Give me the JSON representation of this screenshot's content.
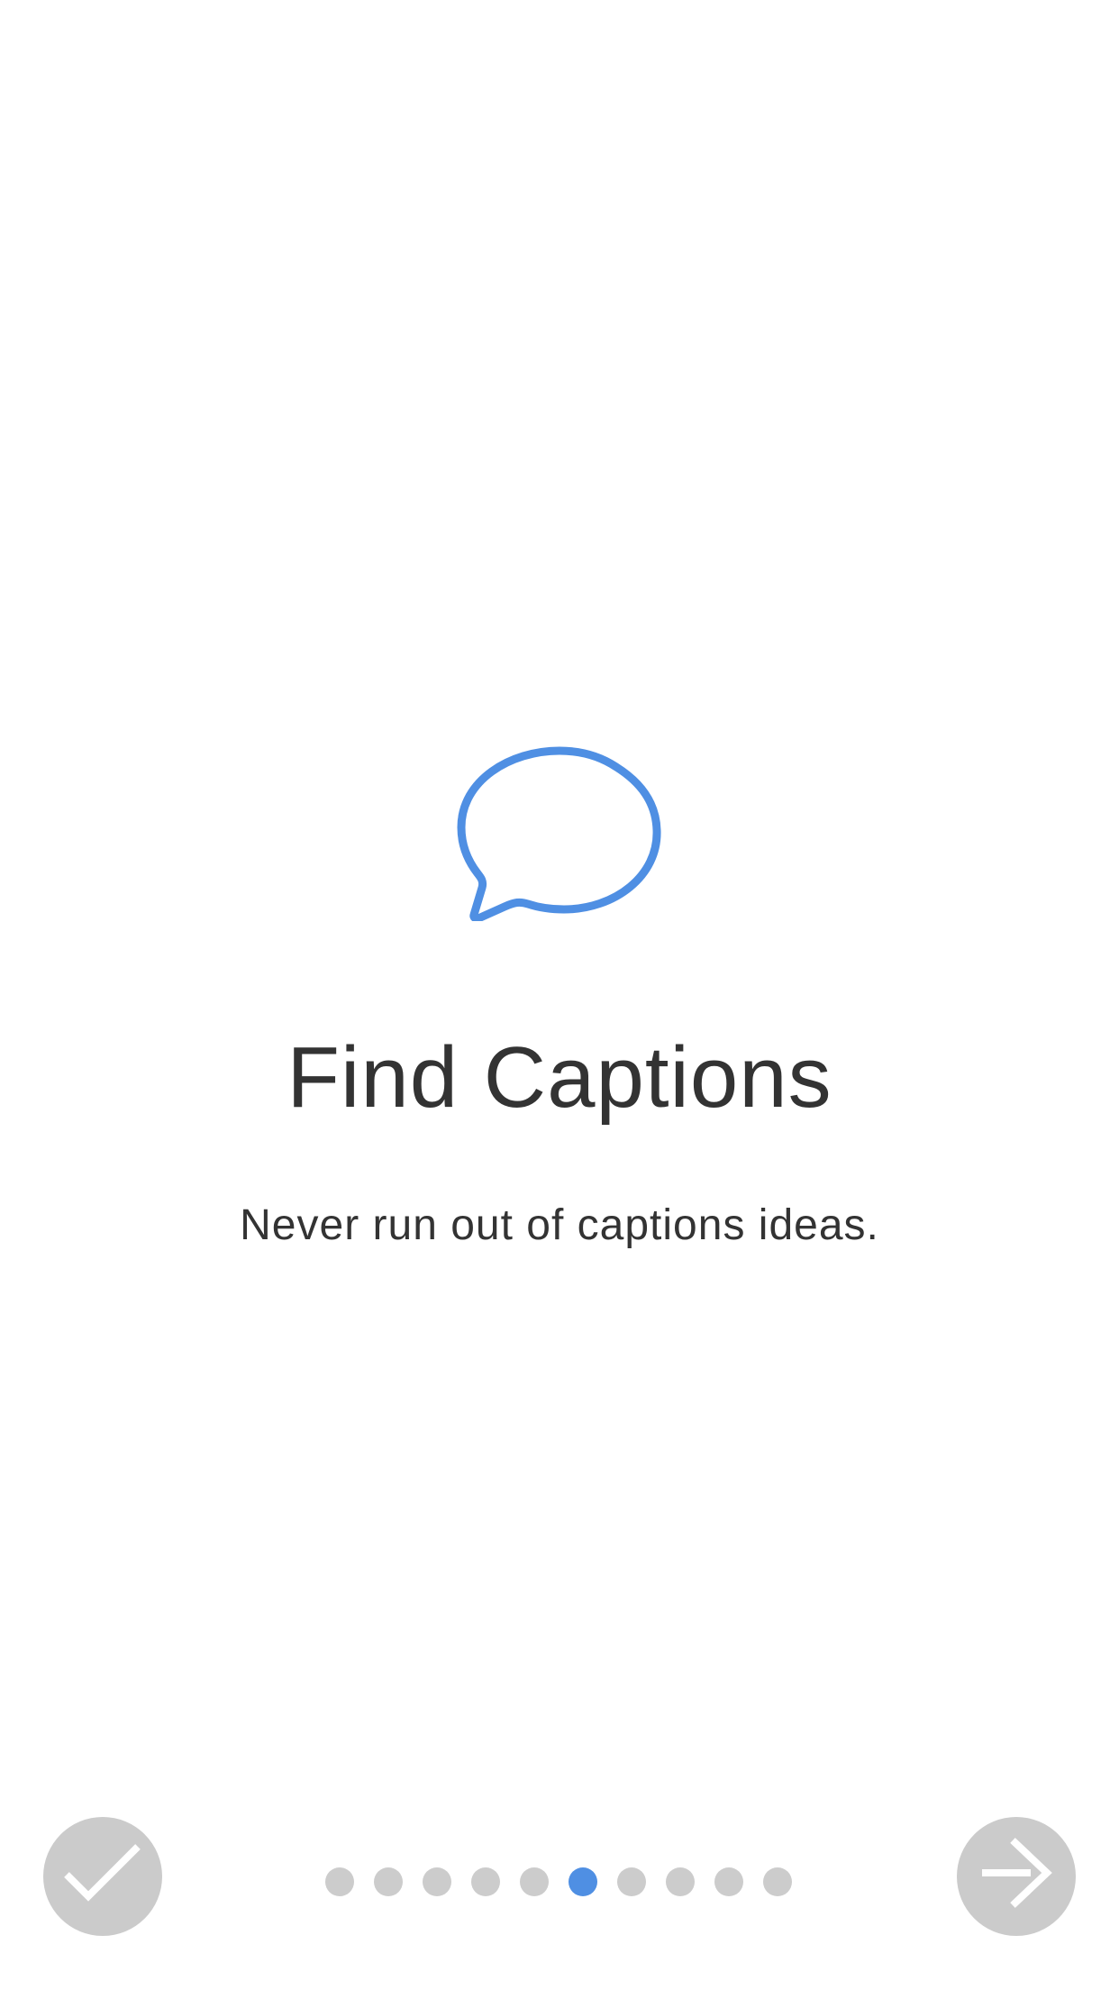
{
  "onboarding": {
    "title": "Find Captions",
    "subtitle": "Never run out of captions ideas.",
    "icon": "speech-bubble-icon",
    "accent_color": "#4f8fe3",
    "text_color": "#333333",
    "button_color": "#cbcbcb"
  },
  "navigation": {
    "done_icon": "checkmark-icon",
    "next_icon": "arrow-right-icon"
  },
  "page_indicator": {
    "total_pages": 10,
    "current_page": 6,
    "inactive_color": "#cccccc",
    "active_color": "#4f8fe3"
  }
}
